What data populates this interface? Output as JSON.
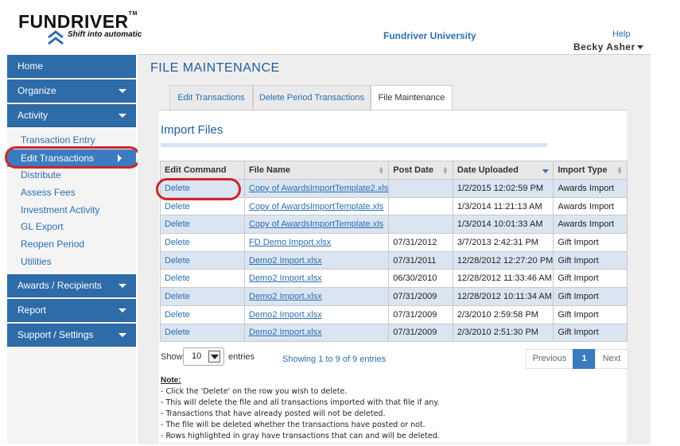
{
  "header": {
    "logo_text": "FUNDRIVER",
    "logo_tm": "TM",
    "logo_tagline": "Shift into automatic",
    "university_link": "Fundriver University",
    "help_link": "Help",
    "user_name": "Becky Asher"
  },
  "sidebar": {
    "main_items": [
      {
        "label": "Home",
        "has_caret": false
      },
      {
        "label": "Organize",
        "has_caret": true
      },
      {
        "label": "Activity",
        "has_caret": true
      },
      {
        "label": "Awards / Recipients",
        "has_caret": true
      },
      {
        "label": "Report",
        "has_caret": true
      },
      {
        "label": "Support / Settings",
        "has_caret": true
      }
    ],
    "activity_items": [
      "Transaction Entry",
      "Edit Transactions",
      "Distribute",
      "Assess Fees",
      "Investment Activity",
      "GL Export",
      "Reopen Period",
      "Utilities"
    ],
    "active_item": "Edit Transactions"
  },
  "page": {
    "title": "FILE MAINTENANCE",
    "tabs": [
      {
        "label": "Edit Transactions",
        "active": false
      },
      {
        "label": "Delete Period Transactions",
        "active": false
      },
      {
        "label": "File Maintenance",
        "active": true
      }
    ],
    "section_title": "Import Files"
  },
  "table": {
    "columns": [
      "Edit Command",
      "File Name",
      "Post Date",
      "Date Uploaded",
      "Import Type"
    ],
    "rows": [
      {
        "cmd": "Delete",
        "file": "Copy of AwardsImportTemplate2.xls",
        "post": "",
        "uploaded": "1/2/2015 12:02:59 PM",
        "type": "Awards Import"
      },
      {
        "cmd": "Delete",
        "file": "Copy of AwardsImportTemplate.xls",
        "post": "",
        "uploaded": "1/3/2014 11:21:13 AM",
        "type": "Awards Import"
      },
      {
        "cmd": "Delete",
        "file": "Copy of AwardsImportTemplate.xls",
        "post": "",
        "uploaded": "1/3/2014 10:01:33 AM",
        "type": "Awards Import"
      },
      {
        "cmd": "Delete",
        "file": "FD Demo Import.xlsx",
        "post": "07/31/2012",
        "uploaded": "3/7/2013 2:42:31 PM",
        "type": "Gift Import"
      },
      {
        "cmd": "Delete",
        "file": "Demo2 Import.xlsx",
        "post": "07/31/2011",
        "uploaded": "12/28/2012 12:27:20 PM",
        "type": "Gift Import"
      },
      {
        "cmd": "Delete",
        "file": "Demo2 Import.xlsx",
        "post": "06/30/2010",
        "uploaded": "12/28/2012 11:33:46 AM",
        "type": "Gift Import"
      },
      {
        "cmd": "Delete",
        "file": "Demo2 Import.xlsx",
        "post": "07/31/2009",
        "uploaded": "12/28/2012 10:11:34 AM",
        "type": "Gift Import"
      },
      {
        "cmd": "Delete",
        "file": "Demo2 Import.xlsx",
        "post": "07/31/2009",
        "uploaded": "2/3/2010 2:59:58 PM",
        "type": "Gift Import"
      },
      {
        "cmd": "Delete",
        "file": "Demo2 Import.xlsx",
        "post": "07/31/2009",
        "uploaded": "2/3/2010 2:51:30 PM",
        "type": "Gift Import"
      }
    ]
  },
  "controls": {
    "show_label": "Show",
    "entries_value": "10",
    "entries_label": "entries",
    "showing_text": "Showing 1 to 9 of 9 entries",
    "prev_label": "Previous",
    "current_page": "1",
    "next_label": "Next"
  },
  "note": {
    "heading": "Note:",
    "lines": [
      "- Click the 'Delete' on the row you wish to delete.",
      "- This will delete the file and all transactions imported with that file if any.",
      "- Transactions that have already posted will not be deleted.",
      "- The file will be deleted whether the transactions have posted or not.",
      "- Rows highlighted in gray have transactions that can and will be deleted."
    ]
  },
  "colors": {
    "nav_blue": "#2e6ca9",
    "link_blue": "#2a6fb1",
    "alt_row": "#dbe5f2",
    "highlight_red": "#d0242b"
  }
}
